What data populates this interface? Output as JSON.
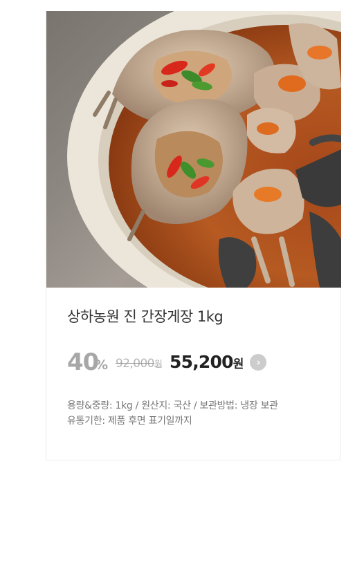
{
  "product": {
    "image_alt": "간장게장",
    "title": "상하농원 진 간장게장 1kg",
    "discount_rate": "40",
    "discount_unit": "%",
    "original_price": "92,000",
    "original_unit": "원",
    "sale_price": "55,200",
    "sale_unit": "원",
    "go_icon": "chevron-right-icon",
    "info_line_1": "용량&중량: 1kg / 원산지: 국산 / 보관방법: 냉장 보관",
    "info_line_2": "유통기한: 제품 후면 표기일까지"
  }
}
